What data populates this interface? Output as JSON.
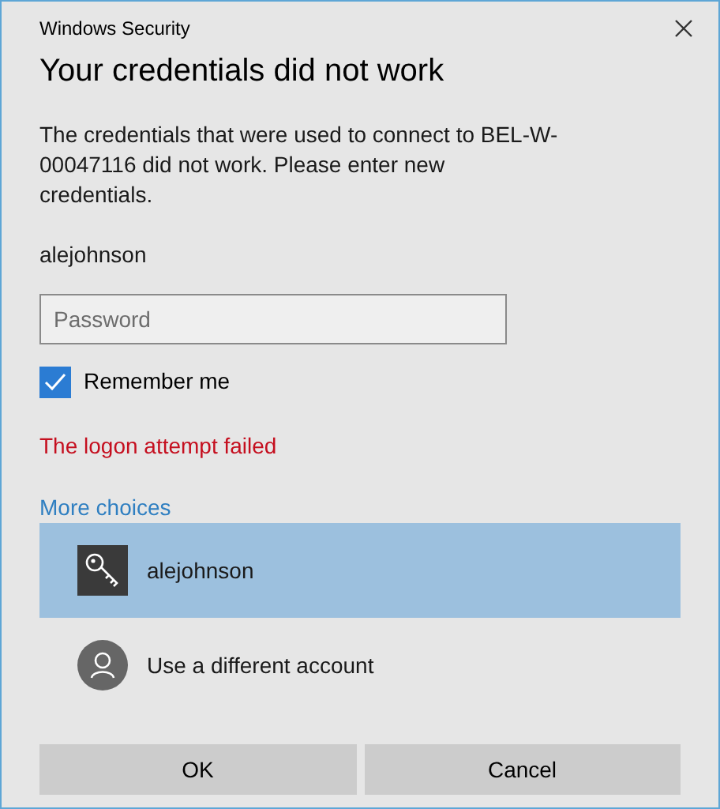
{
  "window": {
    "title": "Windows Security"
  },
  "heading": "Your credentials did not work",
  "message": "The credentials that were used to connect to BEL-W-00047116 did not work. Please enter new credentials.",
  "username": "alejohnson",
  "password_field": {
    "placeholder": "Password"
  },
  "remember_me": {
    "label": "Remember me",
    "checked": true
  },
  "error": "The logon attempt failed",
  "more_choices": "More choices",
  "choices": [
    {
      "kind": "key",
      "label": "alejohnson",
      "selected": true
    },
    {
      "kind": "person",
      "label": "Use a different account",
      "selected": false
    }
  ],
  "buttons": [
    "OK",
    "Cancel"
  ]
}
